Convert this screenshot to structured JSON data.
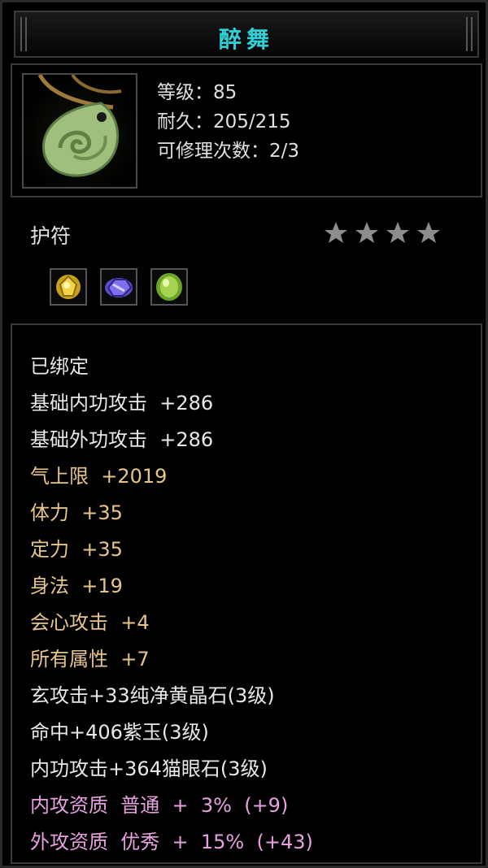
{
  "item": {
    "name": "醉舞",
    "level": "等级：85",
    "durability": "耐久：205/215",
    "repairs": "可修理次数：2/3",
    "category": "护符",
    "star_rating": 4,
    "gems": [
      "gold-gem-icon",
      "purple-gem-icon",
      "green-gem-icon"
    ]
  },
  "attributes": {
    "bound": "已绑定",
    "base_inner_attack": "基础内功攻击  +286",
    "base_outer_attack": "基础外功攻击  +286",
    "qi_cap": "气上限  +2019",
    "stamina": "体力  +35",
    "focus": "定力  +35",
    "agility": "身法  +19",
    "crit_attack": "会心攻击  +4",
    "all_attributes": "所有属性  +7",
    "gem1": "玄攻击+33纯净黄晶石(3级)",
    "gem2": "命中+406紫玉(3级)",
    "gem3": "内功攻击+364猫眼石(3级)",
    "inner_quality": "内攻资质  普通  +  3%  (+9)",
    "outer_quality": "外攻资质  优秀  +  15%  (+43)"
  },
  "colors": {
    "title": "#2fd0d6",
    "white_text": "#e8e8e8",
    "yellow_text": "#e6c58a",
    "pink_text": "#e7a0e0",
    "star": "#8c8c8c"
  }
}
